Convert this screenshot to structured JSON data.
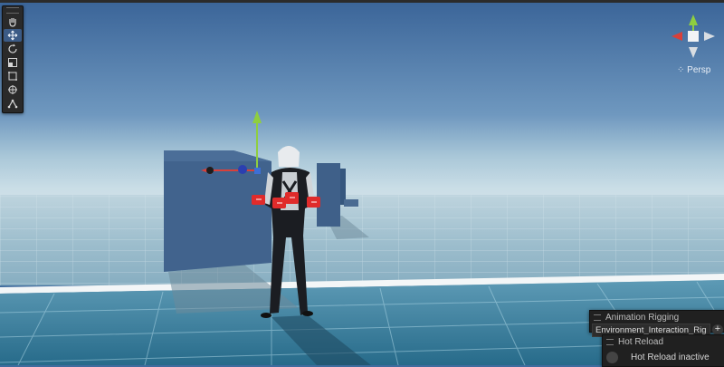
{
  "toolbar": {
    "tools": [
      {
        "icon": "hand-tool-icon",
        "active": false
      },
      {
        "icon": "move-tool-icon",
        "active": true
      },
      {
        "icon": "rotate-tool-icon",
        "active": false
      },
      {
        "icon": "scale-tool-icon",
        "active": false
      },
      {
        "icon": "rect-tool-icon",
        "active": false
      },
      {
        "icon": "transform-tool-icon",
        "active": false
      },
      {
        "icon": "custom-tool-icon",
        "active": false
      }
    ]
  },
  "gizmo": {
    "mode_label": "Persp",
    "axis_colors": {
      "x": "#d9403a",
      "y": "#8fce3f",
      "z": "#3d6fd6"
    }
  },
  "overlays": {
    "animation_rigging": {
      "title": "Animation Rigging",
      "rig_name": "Environment_Interaction_Rig",
      "add_label": "+"
    },
    "hot_reload": {
      "title": "Hot Reload",
      "status": "Hot Reload inactive"
    }
  },
  "colors": {
    "sky_top": "#3a6498",
    "sky_horizon": "#c8dde6",
    "ground": "#2e6f8c",
    "wall": "#3f6089",
    "handle_red": "#e02b2b",
    "accent_blue": "#3b5b86"
  }
}
